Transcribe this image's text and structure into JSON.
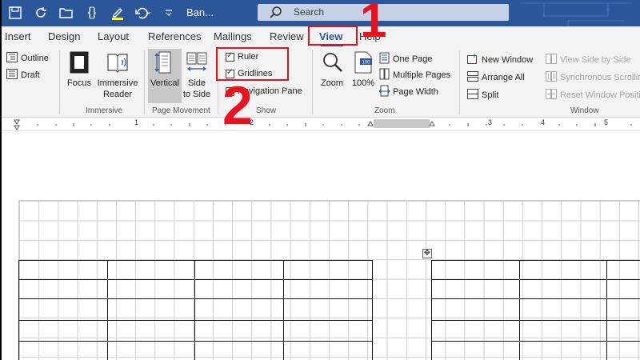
{
  "titlebar": {
    "doc_title": "Bạn...",
    "search_placeholder": "Search",
    "qat_icons": [
      "save-icon",
      "autosave-icon",
      "open-folder-icon",
      "braces-icon",
      "highlighter-icon",
      "undo-icon",
      "customize-icon"
    ]
  },
  "tabs": [
    {
      "label": "Insert",
      "active": false
    },
    {
      "label": "Design",
      "active": false
    },
    {
      "label": "Layout",
      "active": false
    },
    {
      "label": "References",
      "active": false
    },
    {
      "label": "Mailings",
      "active": false
    },
    {
      "label": "Review",
      "active": false
    },
    {
      "label": "View",
      "active": true
    },
    {
      "label": "Help",
      "active": false
    }
  ],
  "ribbon": {
    "views": {
      "outline": "Outline",
      "draft": "Draft"
    },
    "immersive": {
      "focus": "Focus",
      "reader_line1": "Immersive",
      "reader_line2": "Reader",
      "group_label": "Immersive"
    },
    "page_movement": {
      "vertical": "Vertical",
      "side_line1": "Side",
      "side_line2": "to Side",
      "group_label": "Page Movement"
    },
    "show": {
      "ruler": "Ruler",
      "ruler_checked": true,
      "gridlines": "Gridlines",
      "gridlines_checked": true,
      "nav_pane": "Navigation Pane",
      "nav_pane_checked": false,
      "group_label": "Show"
    },
    "zoom": {
      "zoom": "Zoom",
      "hundred": "100%",
      "one_page": "One Page",
      "multiple_pages": "Multiple Pages",
      "page_width": "Page Width",
      "group_label": "Zoom"
    },
    "window": {
      "new_window": "New Window",
      "arrange_all": "Arrange All",
      "split": "Split",
      "view_side_by_side": "View Side by Side",
      "sync_scrolling": "Synchronous Scrolling",
      "reset_window": "Reset Window Position",
      "group_label": "Window"
    }
  },
  "ruler": {
    "numbers": [
      "1",
      "1",
      "2",
      "3",
      "4",
      "5"
    ]
  },
  "annotations": {
    "step1": "1",
    "step2": "2"
  },
  "colors": {
    "accent": "#2b579a",
    "annotation": "#e8121f"
  }
}
